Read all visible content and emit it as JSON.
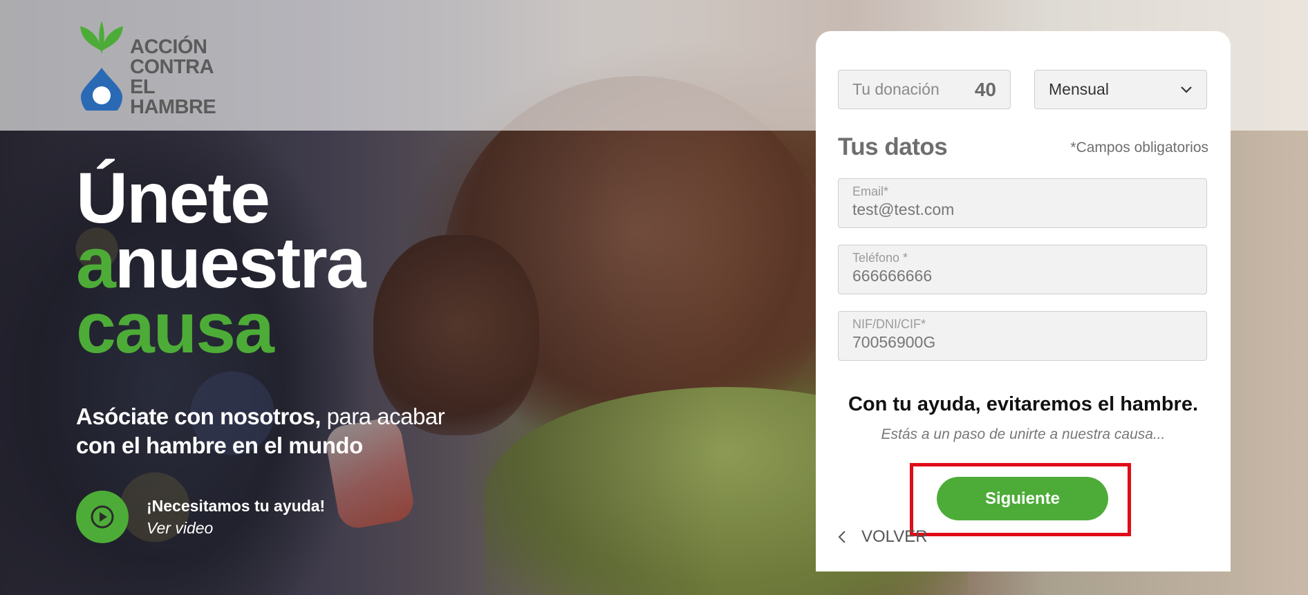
{
  "brand": {
    "logo_lines": [
      "ACCIÓN",
      "CONTRA EL",
      "HAMBRE"
    ],
    "green": "#4dac37",
    "highlight_red": "#e10b17"
  },
  "hero": {
    "headline_line1": "Únete",
    "headline_line2_green": "a",
    "headline_line2_white": "nuestra",
    "headline_line3": "causa",
    "subhead_bold": "Asóciate con nosotros,",
    "subhead_regular": " para acabar",
    "subhead_line2": "con el hambre en el mundo",
    "video_need": "¡Necesitamos tu ayuda!",
    "video_link": "Ver video",
    "icons": {
      "play": "play-icon"
    }
  },
  "form": {
    "donation_label": "Tu donación",
    "donation_value": "40",
    "frequency_value": "Mensual",
    "section_title": "Tus datos",
    "required_note": "*Campos obligatorios",
    "email_label": "Email*",
    "email_value": "test@test.com",
    "phone_label": "Teléfono *",
    "phone_value": "666666666",
    "nif_label": "NIF/DNI/CIF*",
    "nif_value": "70056900G",
    "cta_title": "Con tu ayuda, evitaremos el hambre.",
    "cta_sub": "Estás a un paso de unirte a nuestra causa...",
    "next_label": "Siguiente",
    "back_label": "VOLVER",
    "icons": {
      "dropdown": "chevron-down-icon",
      "back": "chevron-left-icon"
    }
  }
}
